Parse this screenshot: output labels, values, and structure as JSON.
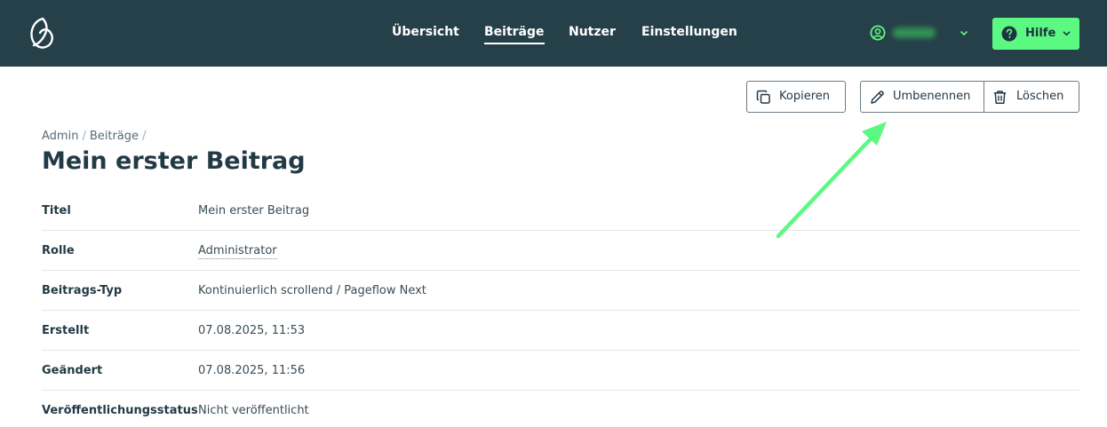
{
  "header": {
    "nav": [
      {
        "label": "Übersicht",
        "active": false
      },
      {
        "label": "Beiträge",
        "active": true
      },
      {
        "label": "Nutzer",
        "active": false
      },
      {
        "label": "Einstellungen",
        "active": false
      }
    ],
    "help_label": "Hilfe"
  },
  "actions": {
    "copy_label": "Kopieren",
    "rename_label": "Umbenennen",
    "delete_label": "Löschen"
  },
  "breadcrumb": {
    "items": [
      "Admin",
      "Beiträge"
    ],
    "separator": "/"
  },
  "page_title": "Mein erster Beitrag",
  "details": [
    {
      "label": "Titel",
      "value": "Mein erster Beitrag"
    },
    {
      "label": "Rolle",
      "value": "Administrator"
    },
    {
      "label": "Beitrags-Typ",
      "value": "Kontinuierlich scrollend / Pageflow Next"
    },
    {
      "label": "Erstellt",
      "value": "07.08.2025, 11:53"
    },
    {
      "label": "Geändert",
      "value": "07.08.2025, 11:56"
    },
    {
      "label": "Veröffentlichungsstatus",
      "value": "Nicht veröffentlicht"
    }
  ],
  "icons": {
    "logo": "pageflow-logo-icon",
    "user": "user-circle-icon",
    "help": "question-circle-icon",
    "copy": "copy-icon",
    "rename": "pencil-icon",
    "delete": "trash-icon"
  },
  "colors": {
    "header_bg": "#264049",
    "accent_green": "#5cf982",
    "text_dark": "#233a45",
    "annotation_arrow": "#5cf982"
  }
}
